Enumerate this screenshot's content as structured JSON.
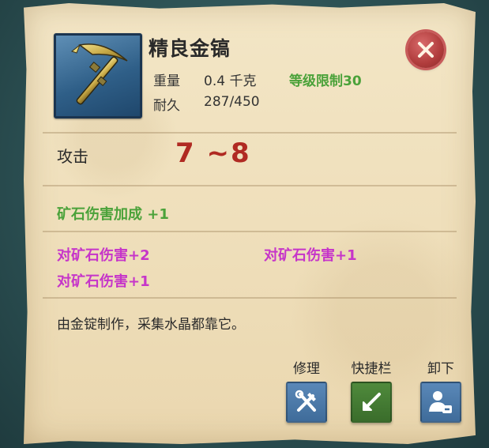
{
  "item": {
    "name": "精良金镐",
    "weight_label": "重量",
    "weight_value": "0.4 千克",
    "level_req": "等级限制30",
    "durability_label": "耐久",
    "durability_value": "287/450",
    "icon": "golden-pickaxe-icon"
  },
  "attack": {
    "label": "攻击",
    "value": "7 ~8"
  },
  "bonuses": {
    "green": "矿石伤害加成 +1",
    "purple": [
      "对矿石伤害+2",
      "对矿石伤害+1",
      "对矿石伤害+1"
    ]
  },
  "description": "由金锭制作，采集水晶都靠它。",
  "actions": [
    {
      "label": "修理",
      "icon": "repair-tools-icon"
    },
    {
      "label": "快捷栏",
      "icon": "shortcut-arrow-icon"
    },
    {
      "label": "卸下",
      "icon": "unequip-user-icon"
    }
  ],
  "colors": {
    "accent_green": "#4ba23a",
    "attack_red": "#b02a22",
    "purple": "#c635c9",
    "close_red": "#b03c3c"
  }
}
